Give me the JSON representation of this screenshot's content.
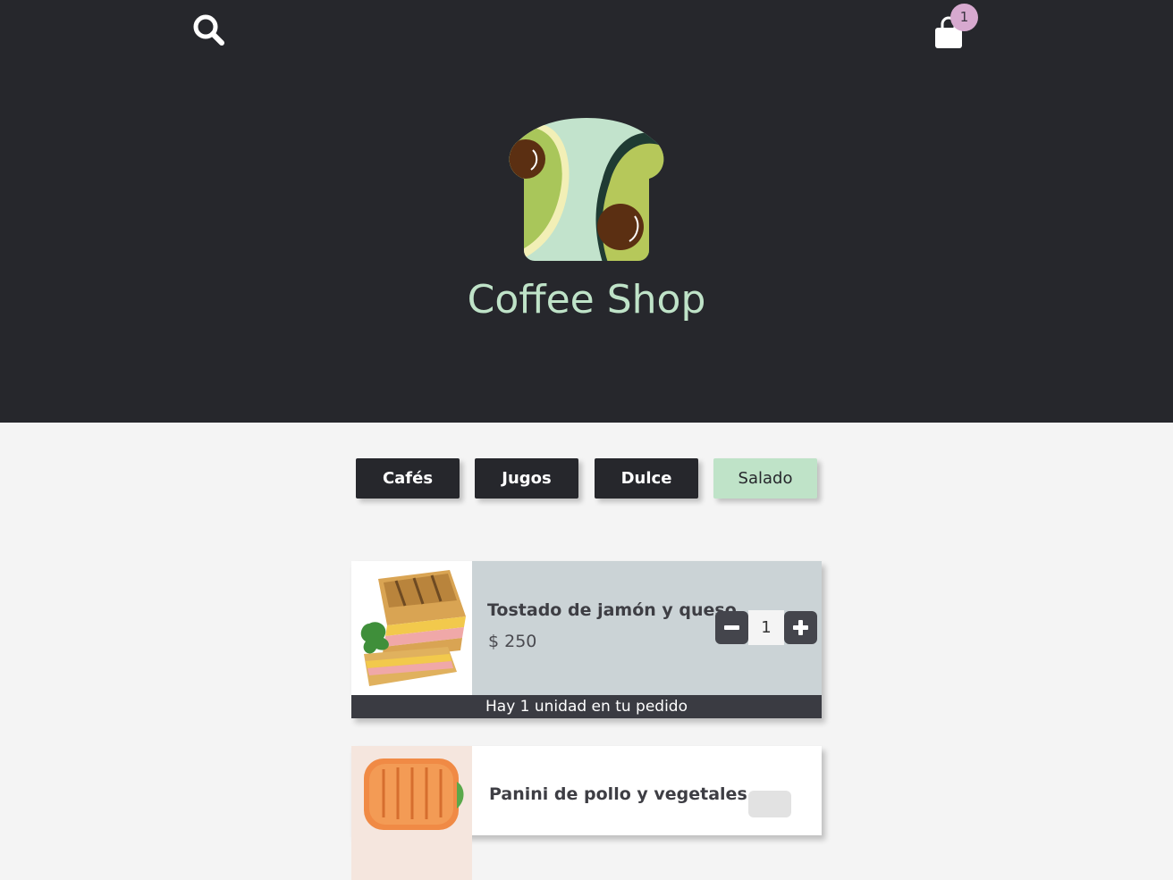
{
  "header": {
    "title": "Coffee Shop",
    "search_icon": "search-icon",
    "cart_icon": "shopping-bag-icon",
    "cart_count": "1"
  },
  "tabs": [
    {
      "label": "Cafés",
      "active": false
    },
    {
      "label": "Jugos",
      "active": false
    },
    {
      "label": "Dulce",
      "active": false
    },
    {
      "label": "Salado",
      "active": true
    }
  ],
  "products": [
    {
      "name": "Tostado de jamón y queso",
      "price": "$ 250",
      "quantity": "1",
      "order_note": "Hay 1 unidad en tu pedido",
      "image_icon": "toasted-sandwich-image"
    },
    {
      "name": "Panini de pollo y vegetales",
      "image_icon": "panini-image"
    }
  ],
  "colors": {
    "header_bg": "#26272c",
    "accent_green": "#bfe3c8",
    "badge": "#d7a9cf",
    "card_info_bg": "#cbd3d6",
    "order_bar_bg": "#3a3b42"
  }
}
